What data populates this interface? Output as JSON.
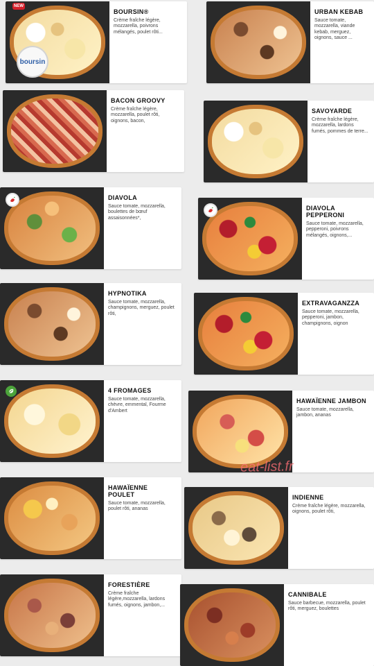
{
  "watermark": "eat-list.fr",
  "badges": {
    "new": "NEW",
    "boursin_logo": "boursin"
  },
  "pizzas": [
    {
      "name": "BOURSIN®",
      "desc": "Crème fraîche légère, mozzarella, poivrons mélangés, poulet rôti..."
    },
    {
      "name": "URBAN KEBAB",
      "desc": "Sauce tomate, mozzarella, viande kebab, merguez, oignons, sauce ..."
    },
    {
      "name": "BACON GROOVY",
      "desc": "Crème fraîche légère, mozzarella, poulet rôti, oignons, bacon,"
    },
    {
      "name": "SAVOYARDE",
      "desc": "Crème fraîche légère, mozzarella, lardons fumés, pommes de terre..."
    },
    {
      "name": "DIAVOLA",
      "desc": "Sauce tomate, mozzarella, boulettes de bœuf assaisonnées*,"
    },
    {
      "name": "DIAVOLA PEPPERONI",
      "desc": "Sauce tomate, mozzarella, pepperoni, poivrons mélangés, oignons,..."
    },
    {
      "name": "HYPNOTIKA",
      "desc": "Sauce tomate, mozzarella, champignons, merguez, poulet rôti,"
    },
    {
      "name": "EXTRAVAGANZZA",
      "desc": "Sauce tomate, mozzarella, pepperoni, jambon, champignons, oignon"
    },
    {
      "name": "4 FROMAGES",
      "desc": "Sauce tomate, mozzarella, chèvre, emmental, Fourme d'Ambert"
    },
    {
      "name": "HAWAÏENNE JAMBON",
      "desc": "Sauce tomate, mozzarella, jambon, ananas"
    },
    {
      "name": "HAWAÏENNE POULET",
      "desc": "Sauce tomate, mozzarella, poulet rôti, ananas"
    },
    {
      "name": "INDIENNE",
      "desc": "Crème fraîche légère, mozzarella, oignons, poulet rôti,"
    },
    {
      "name": "FORESTIÈRE",
      "desc": "Crème fraîche légère,mozzarella, lardons fumés, oignons, jambon,..."
    },
    {
      "name": "CANNIBALE",
      "desc": "Sauce barbecue, mozzarella, poulet rôti, merguez, boulettes"
    }
  ],
  "icons": {
    "chili": "chili-icon",
    "vegetarian": "leaf-icon"
  }
}
